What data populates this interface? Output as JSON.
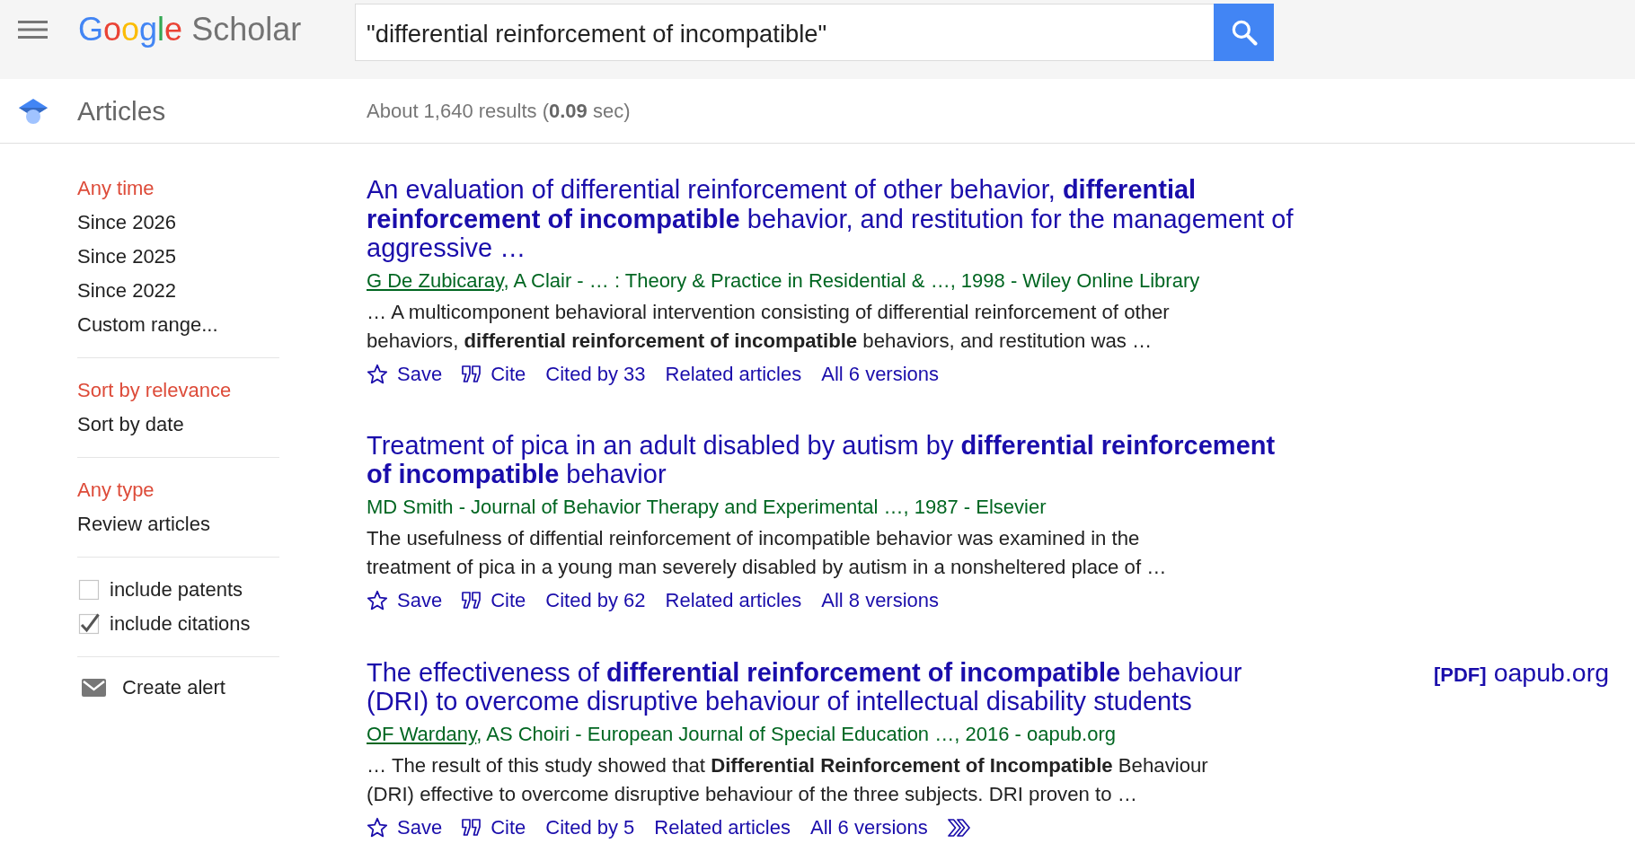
{
  "header": {
    "logo": {
      "brand": "Google",
      "product": "Scholar"
    },
    "search": {
      "value": "\"differential reinforcement of incompatible\""
    }
  },
  "subheader": {
    "section_title": "Articles",
    "results_summary": "About 1,640 results (**0.09** sec)"
  },
  "sidebar": {
    "filter_groups": [
      {
        "options": [
          {
            "label": "Any time",
            "selected": true
          },
          {
            "label": "Since 2026",
            "selected": false
          },
          {
            "label": "Since 2025",
            "selected": false
          },
          {
            "label": "Since 2022",
            "selected": false
          },
          {
            "label": "Custom range...",
            "selected": false
          }
        ]
      },
      {
        "options": [
          {
            "label": "Sort by relevance",
            "selected": true
          },
          {
            "label": "Sort by date",
            "selected": false
          }
        ]
      },
      {
        "options": [
          {
            "label": "Any type",
            "selected": true
          },
          {
            "label": "Review articles",
            "selected": false
          }
        ]
      }
    ],
    "checkboxes": [
      {
        "label": "include patents",
        "checked": false
      },
      {
        "label": "include citations",
        "checked": true
      }
    ],
    "create_alert": {
      "label": "Create alert"
    }
  },
  "results": [
    {
      "title": "An evaluation of differential reinforcement of other behavior, **differential reinforcement of incompatible** behavior, and restitution for the management of aggressive …",
      "source": [
        {
          "text": "G De Zubicaray",
          "link": true
        },
        {
          "text": ", A Clair - … : Theory & Practice in Residential & …, 1998 - Wiley Online Library",
          "link": false
        }
      ],
      "snippet": "… A multicomponent behavioral intervention consisting of differential reinforcement of other behaviors, **differential reinforcement of incompatible** behaviors, and restitution was …",
      "actions": [
        {
          "kind": "save",
          "label": "Save"
        },
        {
          "kind": "cite",
          "label": "Cite"
        },
        {
          "kind": "cited_by",
          "label": "Cited by 33"
        },
        {
          "kind": "related",
          "label": "Related articles"
        },
        {
          "kind": "versions",
          "label": "All 6 versions"
        }
      ]
    },
    {
      "title": "Treatment of pica in an adult disabled by autism by **differential reinforcement of incompatible** behavior",
      "source": [
        {
          "text": "MD Smith - Journal of Behavior Therapy and Experimental …, 1987 - Elsevier",
          "link": false
        }
      ],
      "snippet": "The usefulness of diffential reinforcement of incompatible behavior was examined in the treatment of pica in a young man severely disabled by autism in a nonsheltered place of …",
      "actions": [
        {
          "kind": "save",
          "label": "Save"
        },
        {
          "kind": "cite",
          "label": "Cite"
        },
        {
          "kind": "cited_by",
          "label": "Cited by 62"
        },
        {
          "kind": "related",
          "label": "Related articles"
        },
        {
          "kind": "versions",
          "label": "All 8 versions"
        }
      ]
    },
    {
      "title": "The effectiveness of **differential reinforcement of incompatible** behaviour (DRI) to overcome disruptive behaviour of intellectual disability students",
      "source": [
        {
          "text": "OF Wardany",
          "link": true
        },
        {
          "text": ", AS Choiri - European Journal of Special Education …, 2016 - oapub.org",
          "link": false
        }
      ],
      "snippet": "… The result of this study showed that **Differential Reinforcement of Incompatible** Behaviour (DRI) effective to overcome disruptive behaviour of the three subjects. DRI proven to …",
      "actions": [
        {
          "kind": "save",
          "label": "Save"
        },
        {
          "kind": "cite",
          "label": "Cite"
        },
        {
          "kind": "cited_by",
          "label": "Cited by 5"
        },
        {
          "kind": "related",
          "label": "Related articles"
        },
        {
          "kind": "versions",
          "label": "All 6 versions"
        },
        {
          "kind": "more"
        }
      ],
      "side_link": {
        "tag": "[PDF]",
        "domain": "oapub.org"
      }
    }
  ]
}
